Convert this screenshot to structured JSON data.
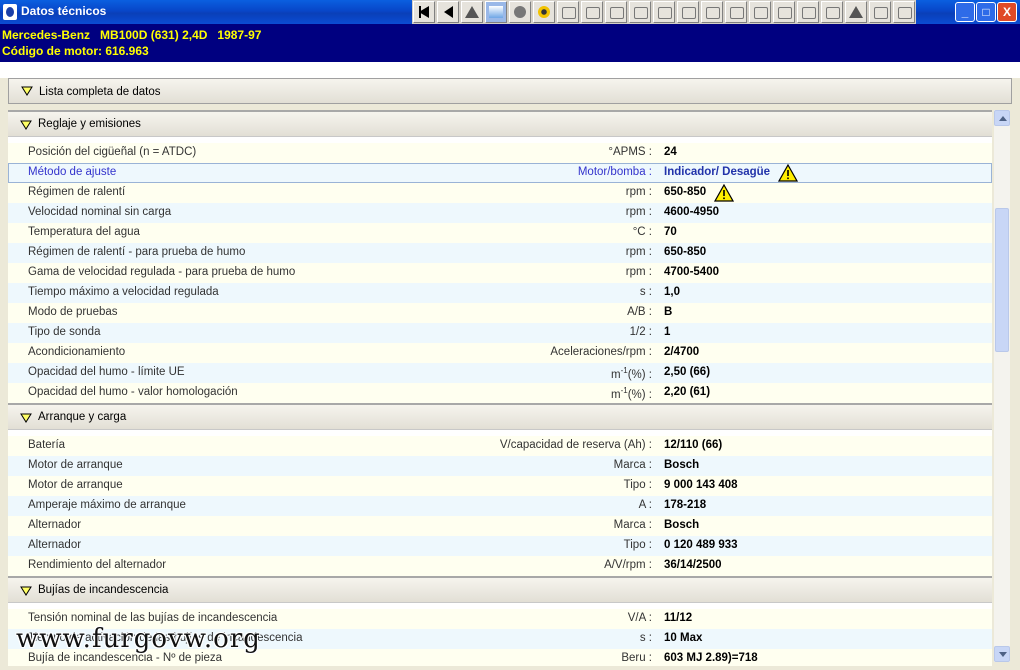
{
  "window": {
    "title": "Datos técnicos",
    "controls": {
      "minimize": "_",
      "maximize": "□",
      "close": "X"
    }
  },
  "toolbar": {
    "icons": [
      "first-icon",
      "prev-icon",
      "warning-icon",
      "data-icon",
      "engine-icon",
      "ignition-icon",
      "fuel-icon",
      "belt-icon",
      "cooling-icon",
      "compression-icon",
      "brake-icon",
      "tool-icon",
      "oil-icon",
      "filter-icon",
      "wheel-icon",
      "steering-icon",
      "suspension-icon",
      "airbag-icon",
      "warning2-icon",
      "car-icon",
      "document-icon"
    ]
  },
  "header": {
    "line1": "Mercedes-Benz   MB100D (631) 2,4D   1987-97",
    "line2": "Código de motor: 616.963"
  },
  "list_header": {
    "label": "Lista completa de datos"
  },
  "sections": [
    {
      "title": "Reglaje y emisiones",
      "rows": [
        {
          "desc": "Posición del cigüeñal (n = ATDC)",
          "unit": "°APMS :",
          "value": "24"
        },
        {
          "desc": "Método de ajuste",
          "unit": "Motor/bomba :",
          "value": "Indicador/ Desagüe",
          "warning": true,
          "selected": true
        },
        {
          "desc": "Régimen de ralentí",
          "unit": "rpm :",
          "value": "650-850",
          "warning": true
        },
        {
          "desc": "Velocidad nominal sin carga",
          "unit": "rpm :",
          "value": "4600-4950"
        },
        {
          "desc": "Temperatura del agua",
          "unit": "°C :",
          "value": "70"
        },
        {
          "desc": "Régimen de ralentí - para prueba de humo",
          "unit": "rpm :",
          "value": "650-850"
        },
        {
          "desc": "Gama de velocidad regulada - para prueba de humo",
          "unit": "rpm :",
          "value": "4700-5400"
        },
        {
          "desc": "Tiempo máximo a velocidad regulada",
          "unit": "s :",
          "value": "1,0"
        },
        {
          "desc": "Modo de pruebas",
          "unit": "A/B :",
          "value": "B"
        },
        {
          "desc": "Tipo de sonda",
          "unit": "1/2 :",
          "value": "1"
        },
        {
          "desc": "Acondicionamiento",
          "unit": "Aceleraciones/rpm :",
          "value": "2/4700"
        },
        {
          "desc": "Opacidad del humo - límite UE",
          "unit": "m-1(%) :",
          "value": "2,50 (66)"
        },
        {
          "desc": "Opacidad del humo - valor homologación",
          "unit": "m-1(%) :",
          "value": "2,20 (61)"
        }
      ]
    },
    {
      "title": "Arranque y carga",
      "rows": [
        {
          "desc": "Batería",
          "unit": "V/capacidad de reserva (Ah) :",
          "value": "12/110 (66)"
        },
        {
          "desc": "Motor de arranque",
          "unit": "Marca :",
          "value": "Bosch"
        },
        {
          "desc": "Motor de arranque",
          "unit": "Tipo :",
          "value": "9 000 143 408"
        },
        {
          "desc": "Amperaje máximo de arranque",
          "unit": "A :",
          "value": "178-218"
        },
        {
          "desc": "Alternador",
          "unit": "Marca :",
          "value": "Bosch"
        },
        {
          "desc": "Alternador",
          "unit": "Tipo :",
          "value": "0 120 489 933"
        },
        {
          "desc": "Rendimiento del alternador",
          "unit": "A/V/rpm :",
          "value": "36/14/2500"
        }
      ]
    },
    {
      "title": "Bujías de incandescencia",
      "rows": [
        {
          "desc": "Tensión nominal de las bujías de incandescencia",
          "unit": "V/A :",
          "value": "11/12"
        },
        {
          "desc": "Tiempo de activación de las bujías de incandescencia",
          "unit": "s :",
          "value": "10 Max"
        },
        {
          "desc": "Bujía de incandescencia - Nº de pieza",
          "unit": "Beru :",
          "value": "603 MJ 2.89)=718"
        }
      ]
    }
  ],
  "watermark": "www.furgovw.org",
  "colors": {
    "title_bar": "#0a4fd0",
    "header_bg": "#000080",
    "header_text": "#ffff00",
    "row_yellow": "#fffff0",
    "row_blue": "#eef8fd"
  }
}
